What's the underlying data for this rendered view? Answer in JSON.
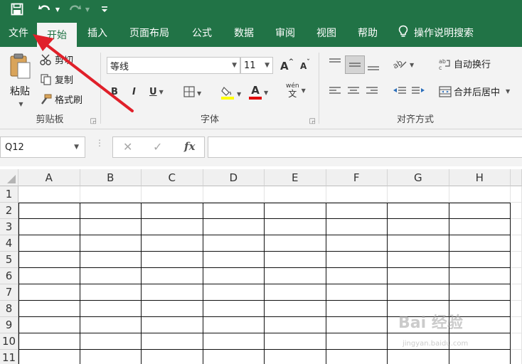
{
  "colors": {
    "accent": "#217346",
    "ribbon_bg": "#f3f3f3",
    "arrow": "#e0202a"
  },
  "tabs": [
    {
      "label": "文件",
      "active": false
    },
    {
      "label": "开始",
      "active": true
    },
    {
      "label": "插入",
      "active": false
    },
    {
      "label": "页面布局",
      "active": false
    },
    {
      "label": "公式",
      "active": false
    },
    {
      "label": "数据",
      "active": false
    },
    {
      "label": "审阅",
      "active": false
    },
    {
      "label": "视图",
      "active": false
    },
    {
      "label": "帮助",
      "active": false
    }
  ],
  "tell_me": {
    "label": "操作说明搜索",
    "icon": "lightbulb-icon"
  },
  "clipboard": {
    "paste_label": "粘贴",
    "cut_label": "剪切",
    "copy_label": "复制",
    "painter_label": "格式刷",
    "group_label": "剪贴板"
  },
  "font": {
    "name": "等线",
    "size": "11",
    "group_label": "字体",
    "bold": "B",
    "italic": "I",
    "underline": "U",
    "grow": "A",
    "shrink": "A",
    "font_color_letter": "A",
    "phonetic_top": "wén",
    "phonetic_bottom": "文"
  },
  "alignment": {
    "wrap_label": "自动换行",
    "merge_label": "合并后居中",
    "group_label": "对齐方式"
  },
  "formula_bar": {
    "name_box": "Q12",
    "fx_label": "fx",
    "cancel_label": "✕",
    "enter_label": "✓",
    "content": ""
  },
  "sheet": {
    "columns": [
      "A",
      "B",
      "C",
      "D",
      "E",
      "F",
      "G",
      "H"
    ],
    "rows": [
      "1",
      "2",
      "3",
      "4",
      "5",
      "6",
      "7",
      "8",
      "9",
      "10",
      "11"
    ],
    "bordered_range": {
      "first_row": 2,
      "first_col": 1
    }
  },
  "watermark": {
    "text": "Bai 经验",
    "sub": "jingyan.baidu.com"
  }
}
